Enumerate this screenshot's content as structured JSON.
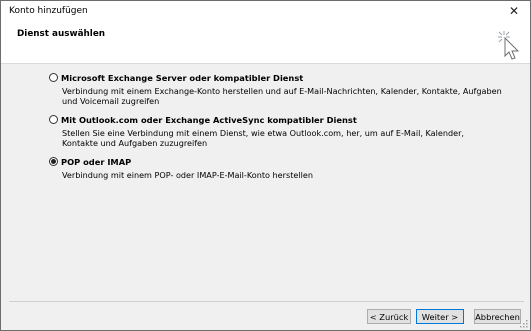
{
  "window": {
    "title": "Konto hinzufügen",
    "close_glyph": "✕"
  },
  "header": {
    "title": "Dienst auswählen",
    "icon": "cursor-sparkle-icon"
  },
  "options": [
    {
      "label": "Microsoft Exchange Server oder kompatibler Dienst",
      "description": "Verbindung mit einem Exchange-Konto herstellen und auf E-Mail-Nachrichten, Kalender, Kontakte, Aufgaben und Voicemail zugreifen",
      "selected": false
    },
    {
      "label": "Mit Outlook.com oder Exchange ActiveSync kompatibler Dienst",
      "description": "Stellen Sie eine Verbindung mit einem Dienst, wie etwa Outlook.com, her, um auf E-Mail, Kalender, Kontakte und Aufgaben zuzugreifen",
      "selected": false
    },
    {
      "label": "POP oder IMAP",
      "description": "Verbindung mit einem POP- oder IMAP-E-Mail-Konto herstellen",
      "selected": true
    }
  ],
  "buttons": {
    "back": "< Zurück",
    "next": "Weiter >",
    "cancel": "Abbrechen"
  }
}
